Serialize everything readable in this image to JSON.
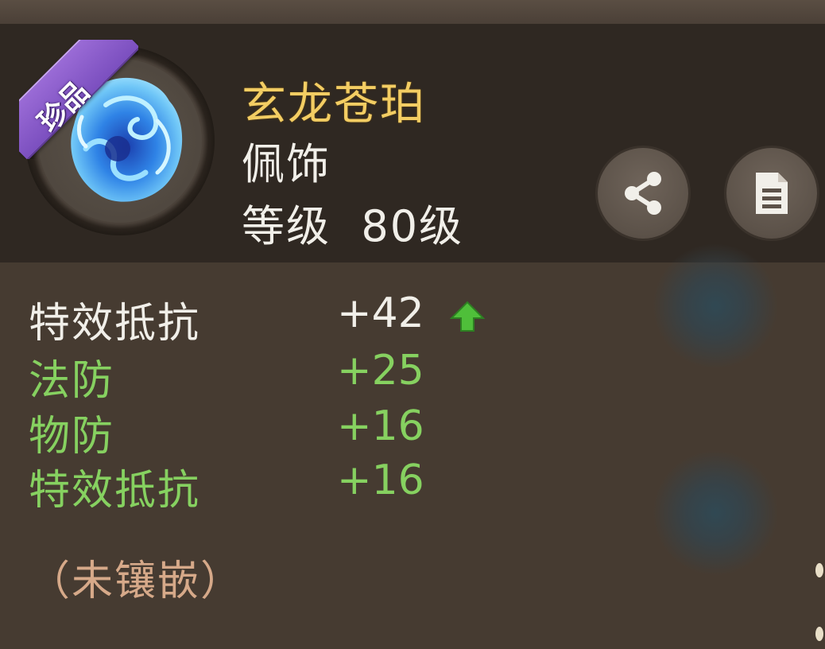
{
  "item": {
    "rarity_badge": "珍品",
    "name": "玄龙苍珀",
    "type": "佩饰",
    "level_label": "等级",
    "level_value": "80级",
    "icon": "blue-dragon-amber-gem-icon"
  },
  "actions": {
    "share_icon": "share-icon",
    "detail_icon": "document-icon"
  },
  "stats": [
    {
      "label": "特效抵抗",
      "value": "+42",
      "color": "#f1efe9",
      "upgrade": true
    },
    {
      "label": "法防",
      "value": "+25",
      "color": "#86d160"
    },
    {
      "label": "物防",
      "value": "+16",
      "color": "#86d160"
    },
    {
      "label": "特效抵抗",
      "value": "+16",
      "color": "#86d160"
    }
  ],
  "socket_status": "（未镶嵌）",
  "colors": {
    "name": "#f3cd63",
    "bonus_green": "#86d160",
    "socket_text": "#d6a989",
    "rarity_purple": "#8a5cc8"
  }
}
